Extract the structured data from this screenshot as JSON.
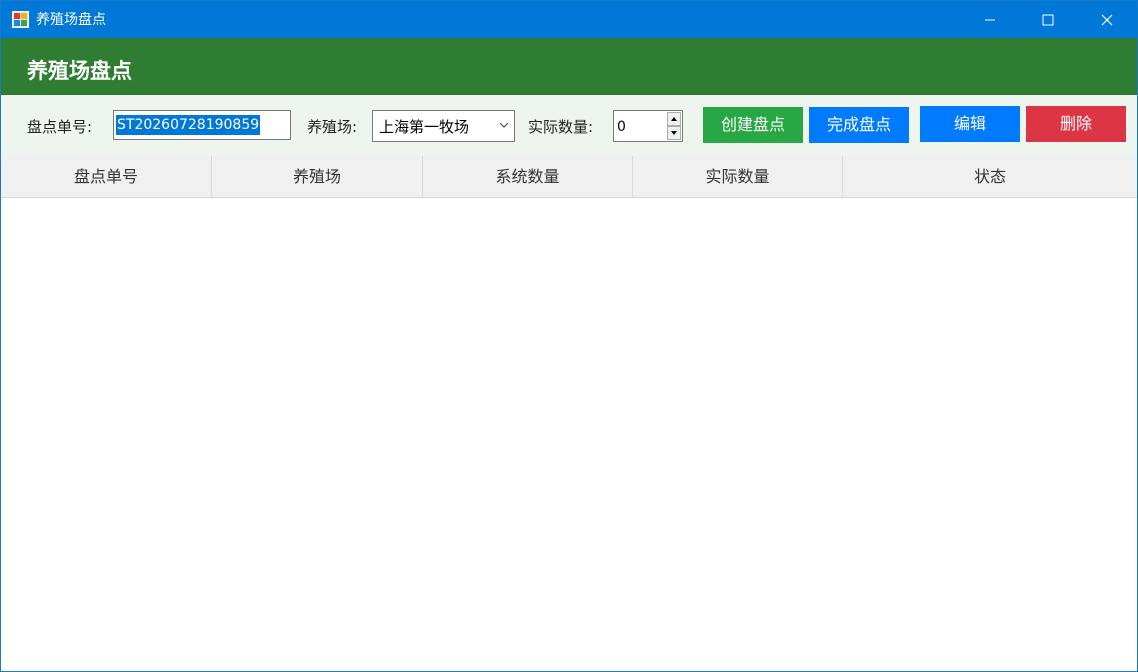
{
  "window": {
    "title": "养殖场盘点",
    "icon": "app-window-icon",
    "controls": [
      "minimize-icon",
      "maximize-icon",
      "close-icon"
    ]
  },
  "header": {
    "title": "养殖场盘点"
  },
  "form": {
    "order_no_label": "盘点单号:",
    "order_no_value": "ST20260728190859",
    "farm_label": "养殖场:",
    "farm_value": "上海第一牧场",
    "actual_qty_label": "实际数量:",
    "actual_qty_value": "0"
  },
  "buttons": {
    "create": "创建盘点",
    "complete": "完成盘点",
    "edit": "编辑",
    "delete": "删除"
  },
  "table": {
    "columns": [
      "盘点单号",
      "养殖场",
      "系统数量",
      "实际数量",
      "状态"
    ],
    "rows": []
  },
  "colors": {
    "titlebar": "#0078d7",
    "header": "#2e7d32",
    "toolbar_bg": "#eef5ee",
    "create_btn": "#28a745",
    "complete_btn": "#007bff",
    "edit_btn": "#007bff",
    "delete_btn": "#dc3545",
    "selection": "#0078d7"
  }
}
